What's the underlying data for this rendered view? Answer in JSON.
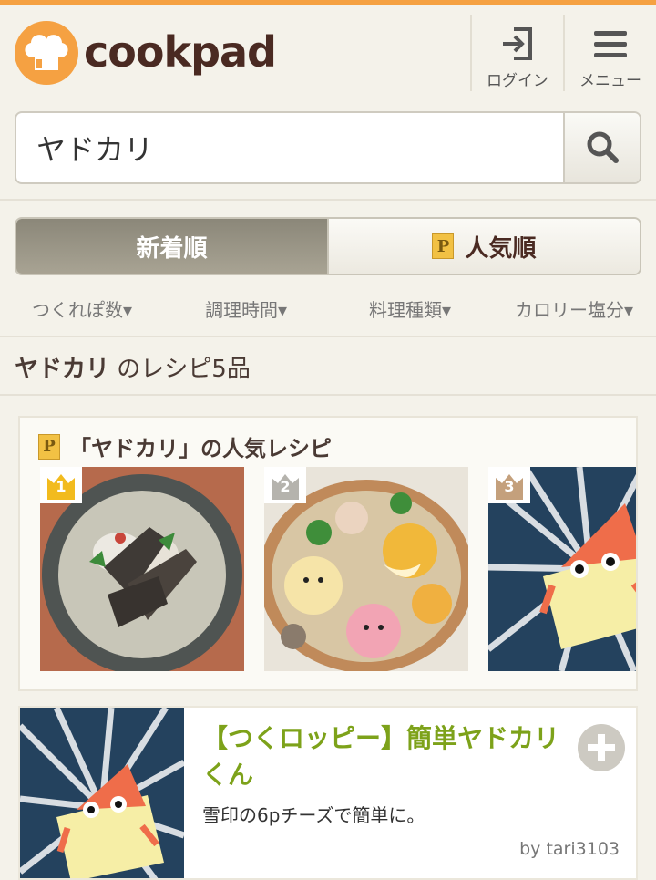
{
  "header": {
    "logo_text": "cookpad",
    "login_label": "ログイン",
    "menu_label": "メニュー"
  },
  "search": {
    "query": "ヤドカリ",
    "placeholder": ""
  },
  "sort_tabs": {
    "newest": "新着順",
    "popular": "人気順",
    "popular_badge": "P"
  },
  "filters": [
    "つくれぽ数▾",
    "調理時間▾",
    "料理種類▾",
    "カロリー塩分▾"
  ],
  "results": {
    "keyword": "ヤドカリ",
    "suffix": " のレシピ5品"
  },
  "popular": {
    "badge": "P",
    "title": "「ヤドカリ」の人気レシピ",
    "ranks": [
      "1",
      "2",
      "3"
    ],
    "rank_colors": [
      "#f2bb1e",
      "#b5b3ad",
      "#c4a07c"
    ]
  },
  "recipe": {
    "title": "【つくロッピー】簡単ヤドカリくん",
    "description": "雪印の6pチーズで簡単に。",
    "author": "by tari3103"
  },
  "colors": {
    "accent": "#f5a142",
    "brand_text": "#4a2a22",
    "recipe_title": "#7da21a"
  },
  "icons": [
    "chef-hat-icon",
    "login-icon",
    "menu-icon",
    "search-icon",
    "crown-icon",
    "plus-icon"
  ]
}
